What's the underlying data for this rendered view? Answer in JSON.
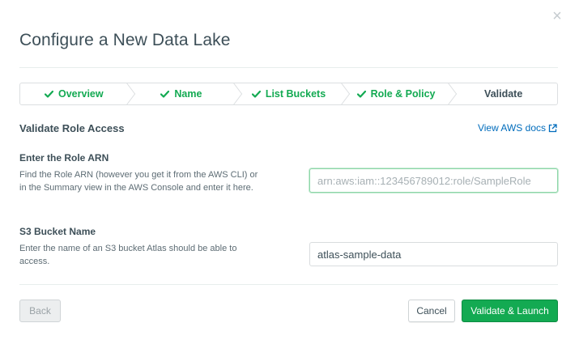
{
  "modal": {
    "title": "Configure a New Data Lake",
    "close_icon": "close-icon"
  },
  "stepper": {
    "steps": [
      {
        "label": "Overview",
        "done": true
      },
      {
        "label": "Name",
        "done": true
      },
      {
        "label": "List Buckets",
        "done": true
      },
      {
        "label": "Role & Policy",
        "done": true
      },
      {
        "label": "Validate",
        "done": false,
        "current": true
      }
    ],
    "check_icon": "checkmark-icon"
  },
  "section": {
    "title": "Validate Role Access",
    "docs_link": "View AWS docs",
    "docs_icon": "external-link-icon"
  },
  "role_arn": {
    "label": "Enter the Role ARN",
    "description": "Find the Role ARN (however you get it from the AWS CLI) or in the Summary view in the AWS Console and enter it here.",
    "placeholder": "arn:aws:iam::123456789012:role/SampleRole",
    "value": ""
  },
  "bucket": {
    "label": "S3 Bucket Name",
    "description": "Enter the name of an S3 bucket Atlas should be able to access.",
    "value": "atlas-sample-data"
  },
  "footer": {
    "back_label": "Back",
    "cancel_label": "Cancel",
    "launch_label": "Validate & Launch"
  },
  "colors": {
    "accent_green": "#13aa52",
    "link_blue": "#006cbc",
    "text": "#3d4f58"
  }
}
